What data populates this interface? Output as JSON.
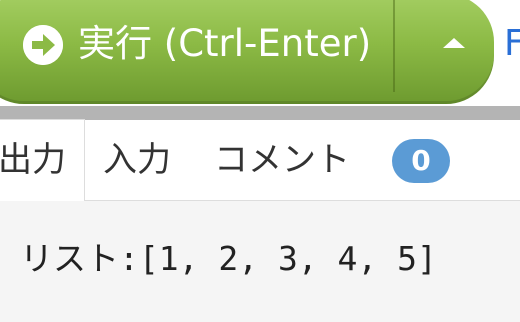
{
  "run_button": {
    "label": "実行 (Ctrl-Enter)",
    "icon": "arrow-circle-right-icon",
    "dropdown_icon": "caret-up-icon",
    "color": "#8cba45"
  },
  "edge_link": {
    "text": "F"
  },
  "tabs": [
    {
      "label": "出力"
    },
    {
      "label": "入力"
    },
    {
      "label": "コメント",
      "badge": "0"
    }
  ],
  "output": {
    "text": "リスト:[1, 2, 3, 4, 5]"
  },
  "colors": {
    "badge": "#5b9bd5",
    "output_background": "#f5f5f5"
  }
}
